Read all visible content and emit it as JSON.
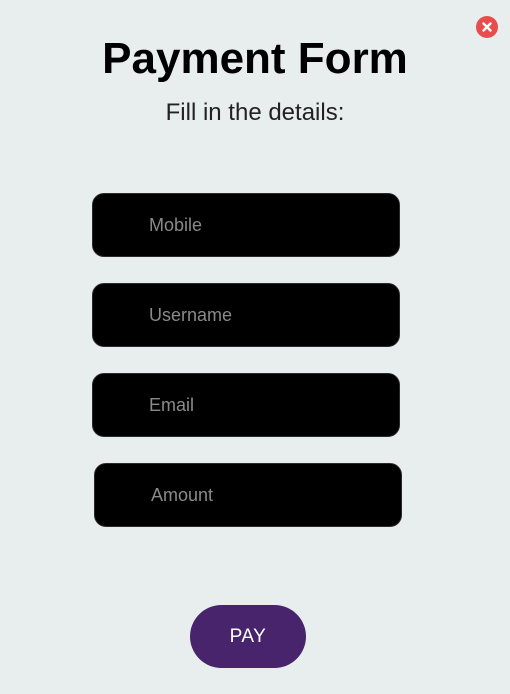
{
  "form": {
    "title": "Payment Form",
    "subtitle": "Fill in the details:",
    "fields": [
      {
        "placeholder": "Mobile",
        "value": ""
      },
      {
        "placeholder": "Username",
        "value": ""
      },
      {
        "placeholder": "Email",
        "value": ""
      },
      {
        "placeholder": "Amount",
        "value": ""
      }
    ],
    "submit_label": "PAY"
  },
  "close": {
    "icon": "close-icon"
  },
  "colors": {
    "background": "#e8edee",
    "field_background": "#000000",
    "pay_button": "#47246b",
    "close_button": "#e84d4d"
  }
}
